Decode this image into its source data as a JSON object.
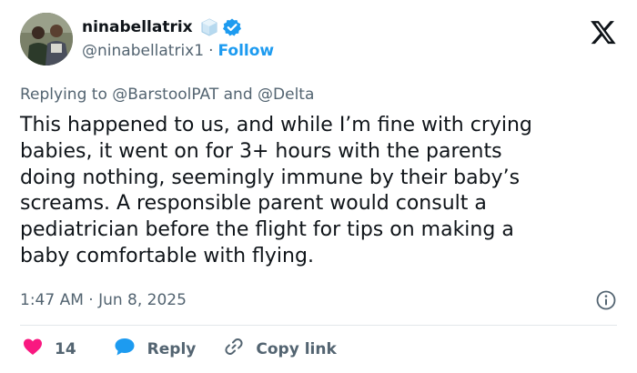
{
  "user": {
    "display_name": "ninabellatrix",
    "handle": "@ninabellatrix1",
    "separator": "·",
    "follow_label": "Follow",
    "badge_emoji_icon": "ice-cube-icon",
    "verified_icon": "verified-badge-icon"
  },
  "reply_context": {
    "prefix": "Replying to",
    "mention_1": "@BarstoolPAT",
    "joiner": "and",
    "mention_2": "@Delta"
  },
  "tweet_text": "This happened to us, and while I’m fine with crying\nbabies, it went on for 3+ hours with the parents\ndoing nothing, seemingly immune by their baby’s\nscreams. A responsible parent would consult a\npediatrician before the flight for tips on making a\nbaby comfortable with flying.",
  "meta": {
    "timestamp": "1:47 AM · Jun 8, 2025"
  },
  "actions": {
    "like_count": "14",
    "reply_label": "Reply",
    "copy_label": "Copy link"
  },
  "colors": {
    "accent": "#1d9bf0",
    "like": "#f91880",
    "muted": "#536471",
    "text": "#0f1419"
  }
}
